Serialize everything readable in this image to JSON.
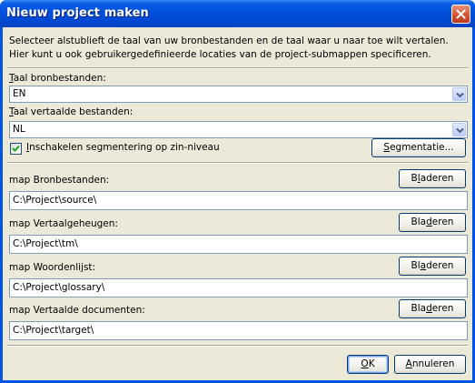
{
  "window": {
    "title": "Nieuw project maken"
  },
  "intro": {
    "line1": "Selecteer alstublieft de taal van uw bronbestanden en de taal waar u naar toe wilt vertalen.",
    "line2": "Hier kunt u ook gebruikergedefinieerde locaties van de project-submappen specificeren."
  },
  "source_lang": {
    "label_key": "T",
    "label_rest": "aal bronbestanden:",
    "value": "EN"
  },
  "target_lang": {
    "label_key": "T",
    "label_rest": "aal vertaalde bestanden:",
    "value": "NL"
  },
  "segmentation": {
    "checked": true,
    "label_key": "I",
    "label_rest": "nschakelen segmentering op zin-niveau",
    "button_key": "S",
    "button_rest": "egmentatie..."
  },
  "folders": [
    {
      "label": "map Bronbestanden:",
      "path": "C:\\Project\\source\\",
      "browse_pre": "B",
      "browse_key": "l",
      "browse_post": "aderen"
    },
    {
      "label": "map Vertaalgeheugen:",
      "path": "C:\\Project\\tm\\",
      "browse_pre": "Bla",
      "browse_key": "d",
      "browse_post": "eren"
    },
    {
      "label": "map Woordenlijst:",
      "path": "C:\\Project\\glossary\\",
      "browse_pre": "Bl",
      "browse_key": "a",
      "browse_post": "deren"
    },
    {
      "label": "map Vertaalde documenten:",
      "path": "C:\\Project\\target\\",
      "browse_pre": "Bla",
      "browse_key": "d",
      "browse_post": "eren"
    }
  ],
  "footer": {
    "ok_key": "O",
    "ok_rest": "K",
    "cancel_key": "A",
    "cancel_rest": "nnuleren"
  },
  "colors": {
    "titlebar": "#0054e3",
    "dialog_bg": "#ece9d8",
    "field_border": "#7f9db9",
    "checkmark": "#21a121"
  }
}
